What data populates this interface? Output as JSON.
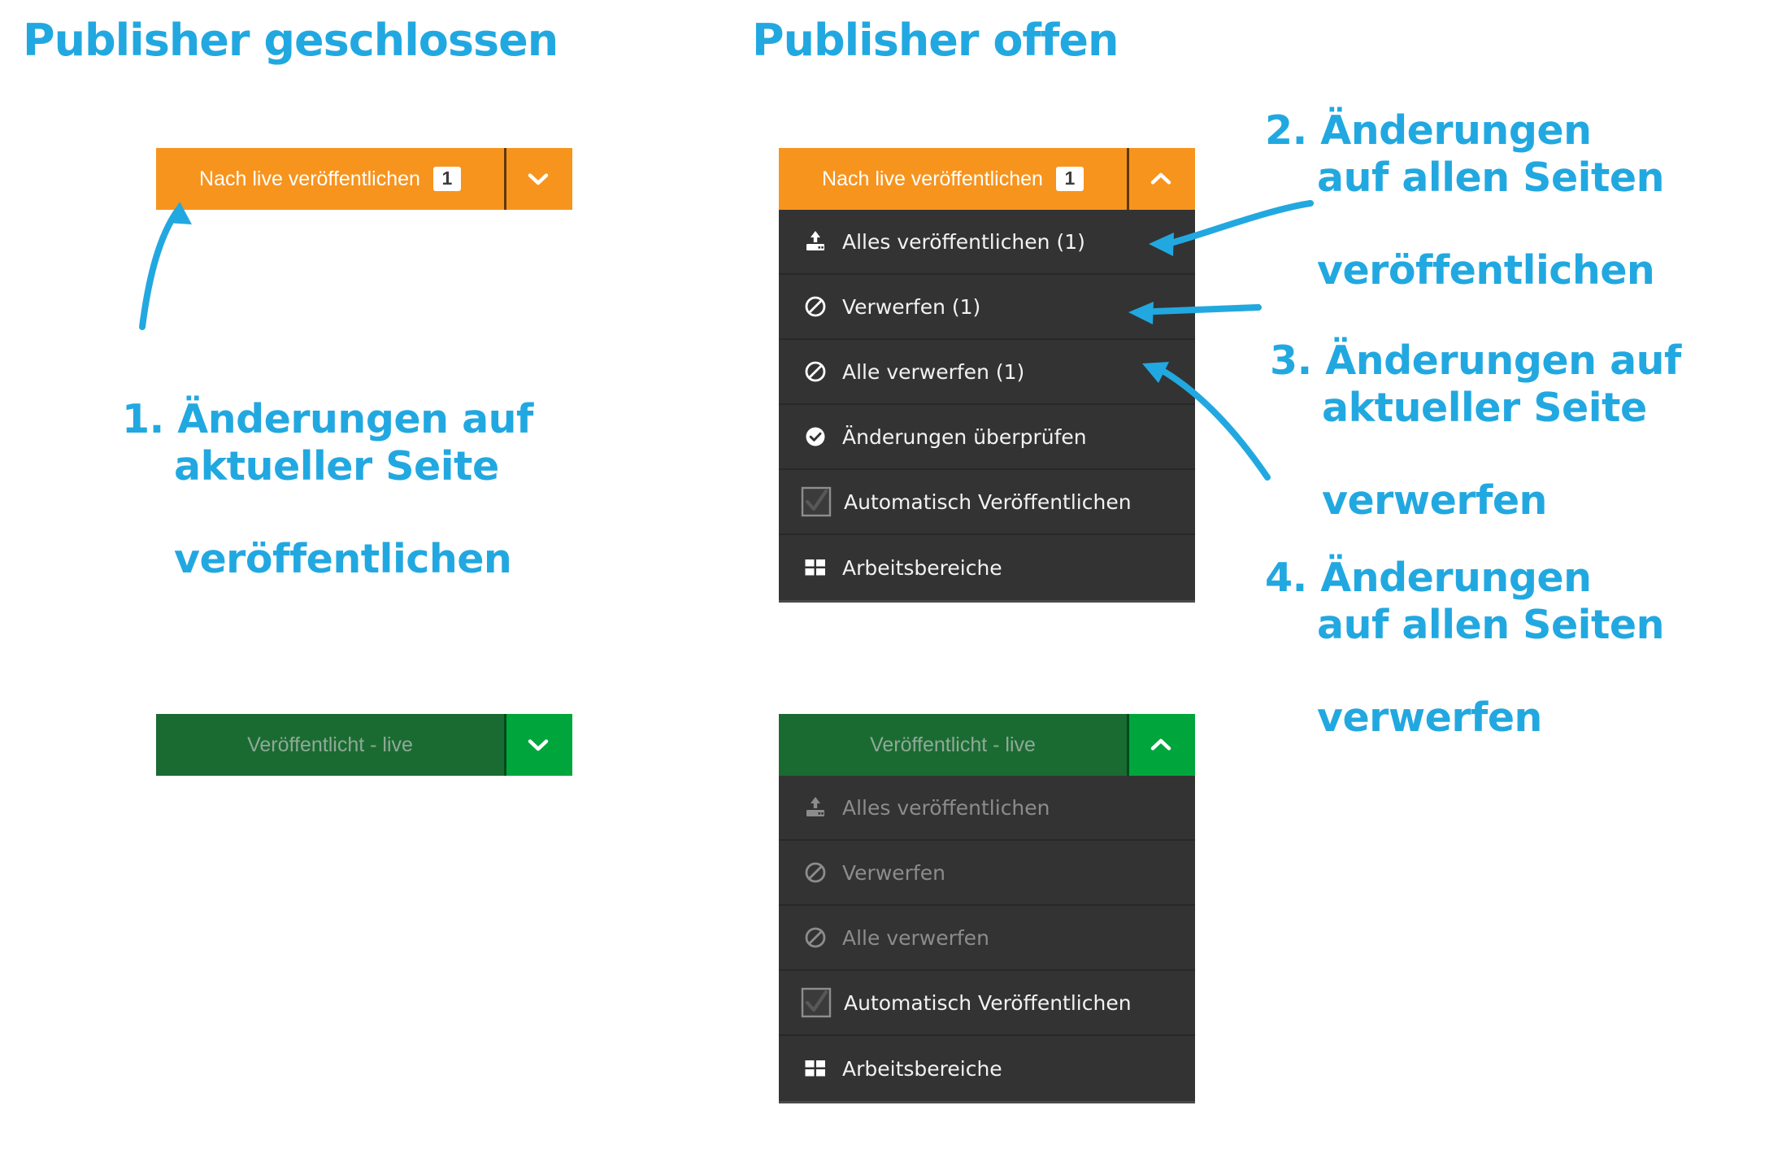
{
  "accent_color": "#22A8E0",
  "orange_color": "#F7941E",
  "green_color": "#1A6B32",
  "green_toggle_color": "#00A63C",
  "menu_bg_color": "#333333",
  "headings": {
    "closed": "Publisher geschlossen",
    "open": "Publisher offen"
  },
  "callouts": [
    {
      "id": "1",
      "line1": "1. Änderungen auf",
      "line2": "aktueller Seite",
      "line3": "veröffentlichen"
    },
    {
      "id": "2",
      "line1": "2. Änderungen",
      "line2": "auf allen Seiten",
      "line3": "veröffentlichen"
    },
    {
      "id": "3",
      "line1": "3. Änderungen auf",
      "line2": "aktueller Seite",
      "line3": "verwerfen"
    },
    {
      "id": "4",
      "line1": "4. Änderungen",
      "line2": "auf allen Seiten",
      "line3": "verwerfen"
    }
  ],
  "orange_button": {
    "label": "Nach live veröffentlichen",
    "badge": "1",
    "chevron_closed": "chevron-down-icon",
    "chevron_open": "chevron-up-icon"
  },
  "green_button": {
    "label": "Veröffentlicht - live",
    "chevron_closed": "chevron-down-icon",
    "chevron_open": "chevron-up-icon"
  },
  "orange_menu": {
    "items": [
      {
        "icon": "publish-upload-icon",
        "label": "Alles veröffentlichen (1)"
      },
      {
        "icon": "block-icon",
        "label": "Verwerfen (1)"
      },
      {
        "icon": "block-icon",
        "label": "Alle verwerfen (1)"
      },
      {
        "icon": "check-circle-icon",
        "label": "Änderungen überprüfen"
      },
      {
        "icon": "checkbox-checked-icon",
        "label": "Automatisch Veröffentlichen"
      },
      {
        "icon": "grid-icon",
        "label": "Arbeitsbereiche"
      }
    ]
  },
  "green_menu": {
    "items": [
      {
        "icon": "publish-upload-icon",
        "label": "Alles veröffentlichen"
      },
      {
        "icon": "block-icon",
        "label": "Verwerfen"
      },
      {
        "icon": "block-icon",
        "label": "Alle verwerfen"
      },
      {
        "icon": "checkbox-checked-icon",
        "label": "Automatisch Veröffentlichen"
      },
      {
        "icon": "grid-icon",
        "label": "Arbeitsbereiche"
      }
    ]
  }
}
